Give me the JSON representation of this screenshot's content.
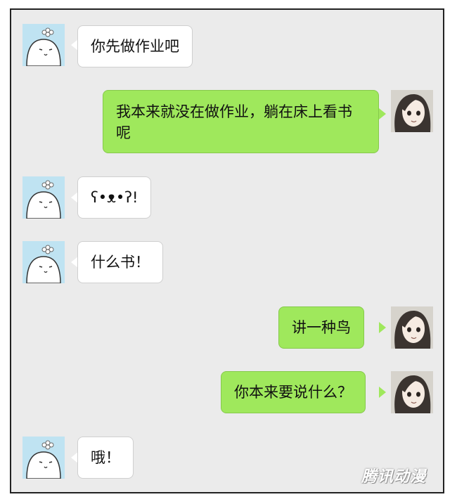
{
  "messages": [
    {
      "side": "left",
      "text": "你先做作业吧"
    },
    {
      "side": "right",
      "text": "我本来就没在做作业，躺在床上看书呢"
    },
    {
      "side": "left",
      "text": "ʕ•ᴥ•ʔ!"
    },
    {
      "side": "left",
      "text": "什么书！"
    },
    {
      "side": "right",
      "text": "讲一种鸟"
    },
    {
      "side": "right",
      "text": "你本来要说什么？"
    },
    {
      "side": "left",
      "text": "哦！"
    }
  ],
  "avatars": {
    "contact": "ghost-avatar-icon",
    "self": "girl-avatar-icon"
  },
  "watermark": "腾讯动漫",
  "colors": {
    "background": "#ebebeb",
    "self_bubble": "#9fe85c",
    "contact_bubble": "#ffffff"
  }
}
